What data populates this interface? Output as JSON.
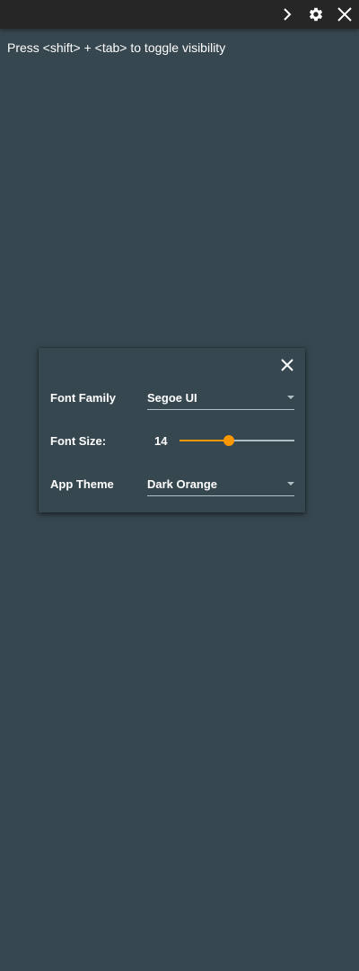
{
  "topbar": {
    "icons": [
      "chevron-right-icon",
      "gear-icon",
      "close-icon"
    ]
  },
  "hint": {
    "text": "Press <shift> + <tab> to toggle visibility"
  },
  "settings_dialog": {
    "close_icon": "close-icon",
    "font_family": {
      "label": "Font Family",
      "value": "Segoe UI"
    },
    "font_size": {
      "label": "Font Size:",
      "value": "14",
      "slider_fraction": 0.43
    },
    "app_theme": {
      "label": "App Theme",
      "value": "Dark Orange"
    }
  },
  "colors": {
    "background": "#37474f",
    "topbar": "#262626",
    "accent": "#ff9800",
    "underline": "#b0bec5"
  }
}
